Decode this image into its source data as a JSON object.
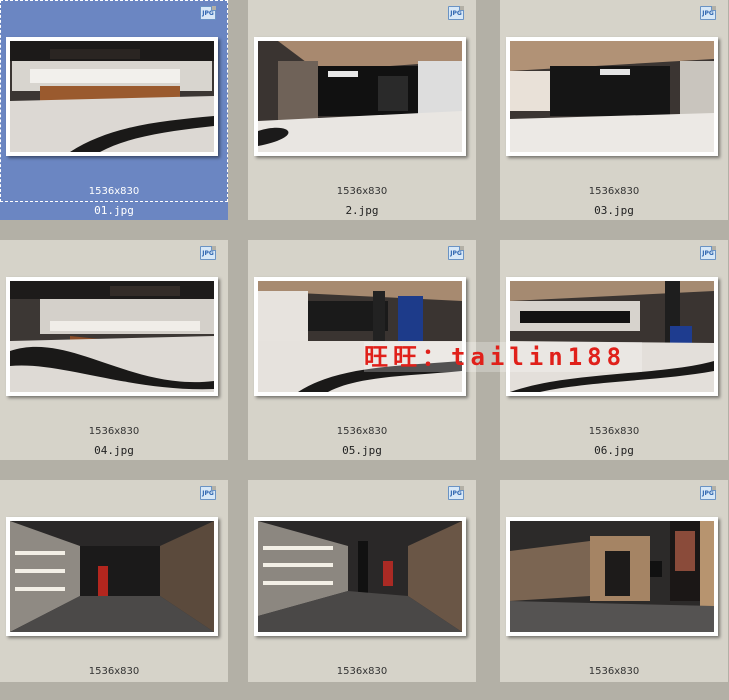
{
  "files": [
    {
      "name": "01.jpg",
      "dims": "1536x830",
      "type_icon": "JPG",
      "selected": true,
      "scene": "counter-left"
    },
    {
      "name": "2.jpg",
      "dims": "1536x830",
      "type_icon": "JPG",
      "selected": false,
      "scene": "storefront"
    },
    {
      "name": "03.jpg",
      "dims": "1536x830",
      "type_icon": "JPG",
      "selected": false,
      "scene": "storefront-wide"
    },
    {
      "name": "04.jpg",
      "dims": "1536x830",
      "type_icon": "JPG",
      "selected": false,
      "scene": "counter-curve"
    },
    {
      "name": "05.jpg",
      "dims": "1536x830",
      "type_icon": "JPG",
      "selected": false,
      "scene": "hall-pillar"
    },
    {
      "name": "06.jpg",
      "dims": "1536x830",
      "type_icon": "JPG",
      "selected": false,
      "scene": "hall-pillar-right"
    },
    {
      "name": "",
      "dims": "1536x830",
      "type_icon": "JPG",
      "selected": false,
      "scene": "dark-gallery"
    },
    {
      "name": "",
      "dims": "1536x830",
      "type_icon": "JPG",
      "selected": false,
      "scene": "dark-gallery-2"
    },
    {
      "name": "",
      "dims": "1536x830",
      "type_icon": "JPG",
      "selected": false,
      "scene": "elevator-lobby"
    }
  ],
  "watermark": {
    "text": "旺旺：tailin188",
    "color": "#e0201a"
  },
  "colors": {
    "background": "#b3b0a6",
    "tile": "#d6d3c9",
    "selection": "#6b86c2"
  }
}
